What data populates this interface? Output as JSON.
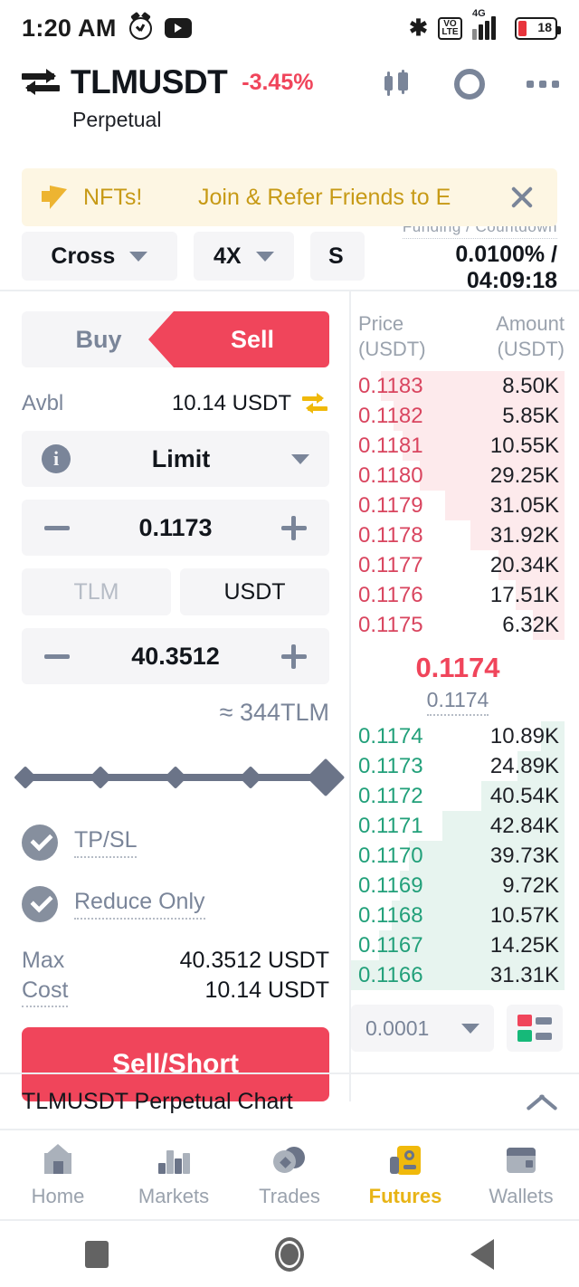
{
  "status_bar": {
    "time": "1:20 AM",
    "alarm_icon": "alarm-icon",
    "youtube_icon": "youtube-icon",
    "bluetooth_glyph": "✱",
    "volte": "VoLTE",
    "network": "4G",
    "battery_level": "18"
  },
  "header": {
    "swap_icon": "swap-arrows-icon",
    "pair": "TLMUSDT",
    "change_pct": "-3.45%",
    "contract_type": "Perpetual",
    "chart_icon": "candlestick-chart-icon",
    "target_icon": "calculator-icon",
    "more_icon": "more-options-icon"
  },
  "banner": {
    "horn_icon": "megaphone-icon",
    "tag": "NFTs!",
    "message": "Join & Refer Friends to E",
    "close_icon": "close-icon"
  },
  "leverage_row": {
    "margin_mode": "Cross",
    "leverage": "4X",
    "third_chip": "S",
    "funding_label": "Funding / Countdown",
    "funding_value": "0.0100% / 04:09:18"
  },
  "order_form": {
    "buy_label": "Buy",
    "sell_label": "Sell",
    "avbl_label": "Avbl",
    "avbl_value": "10.14 USDT",
    "transfer_icon": "transfer-icon",
    "info_icon": "info-icon",
    "order_type": "Limit",
    "price_value": "0.1173",
    "ccy_base": "TLM",
    "ccy_quote": "USDT",
    "amount_value": "40.3512",
    "approx": "≈ 344TLM",
    "slider_percent": 100,
    "tpsl_label": "TP/SL",
    "reduce_only_label": "Reduce Only",
    "max_label": "Max",
    "max_value": "40.3512 USDT",
    "cost_label": "Cost",
    "cost_value": "10.14 USDT",
    "submit_label": "Sell/Short"
  },
  "order_book": {
    "col_price": "Price",
    "col_price_unit": "(USDT)",
    "col_amount": "Amount",
    "col_amount_unit": "(USDT)",
    "asks": [
      {
        "price": "0.1183",
        "amount": "8.50K",
        "depth": 86
      },
      {
        "price": "0.1182",
        "amount": "5.85K",
        "depth": 80
      },
      {
        "price": "0.1181",
        "amount": "10.55K",
        "depth": 76
      },
      {
        "price": "0.1180",
        "amount": "29.25K",
        "depth": 68
      },
      {
        "price": "0.1179",
        "amount": "31.05K",
        "depth": 56
      },
      {
        "price": "0.1178",
        "amount": "31.92K",
        "depth": 44
      },
      {
        "price": "0.1177",
        "amount": "20.34K",
        "depth": 31
      },
      {
        "price": "0.1176",
        "amount": "17.51K",
        "depth": 23
      },
      {
        "price": "0.1175",
        "amount": "6.32K",
        "depth": 15
      }
    ],
    "last_price": "0.1174",
    "mark_price": "0.1174",
    "bids": [
      {
        "price": "0.1174",
        "amount": "10.89K",
        "depth": 11
      },
      {
        "price": "0.1173",
        "amount": "24.89K",
        "depth": 22
      },
      {
        "price": "0.1172",
        "amount": "40.54K",
        "depth": 39
      },
      {
        "price": "0.1171",
        "amount": "42.84K",
        "depth": 57
      },
      {
        "price": "0.1170",
        "amount": "39.73K",
        "depth": 73
      },
      {
        "price": "0.1169",
        "amount": "9.72K",
        "depth": 77
      },
      {
        "price": "0.1168",
        "amount": "10.57K",
        "depth": 81
      },
      {
        "price": "0.1167",
        "amount": "14.25K",
        "depth": 87
      },
      {
        "price": "0.1166",
        "amount": "31.31K",
        "depth": 100
      }
    ],
    "tick_size": "0.0001",
    "depth_view_icon": "orderbook-layout-icon"
  },
  "chart_section": {
    "title": "TLMUSDT Perpetual  Chart",
    "chevron_icon": "chevron-up-icon"
  },
  "bottom_nav": {
    "items": [
      {
        "label": "Home",
        "icon": "home-icon",
        "active": false
      },
      {
        "label": "Markets",
        "icon": "markets-icon",
        "active": false
      },
      {
        "label": "Trades",
        "icon": "trades-icon",
        "active": false
      },
      {
        "label": "Futures",
        "icon": "futures-icon",
        "active": true
      },
      {
        "label": "Wallets",
        "icon": "wallets-icon",
        "active": false
      }
    ]
  },
  "android_nav": {
    "recents_icon": "recents-icon",
    "home_icon": "home-button-icon",
    "back_icon": "back-icon"
  },
  "colors": {
    "sell_red": "#f0455b",
    "buy_green": "#16b979",
    "accent_yellow": "#f0b90b",
    "ask_bar": "#fdeaec",
    "bid_bar": "#e7f4ef"
  }
}
